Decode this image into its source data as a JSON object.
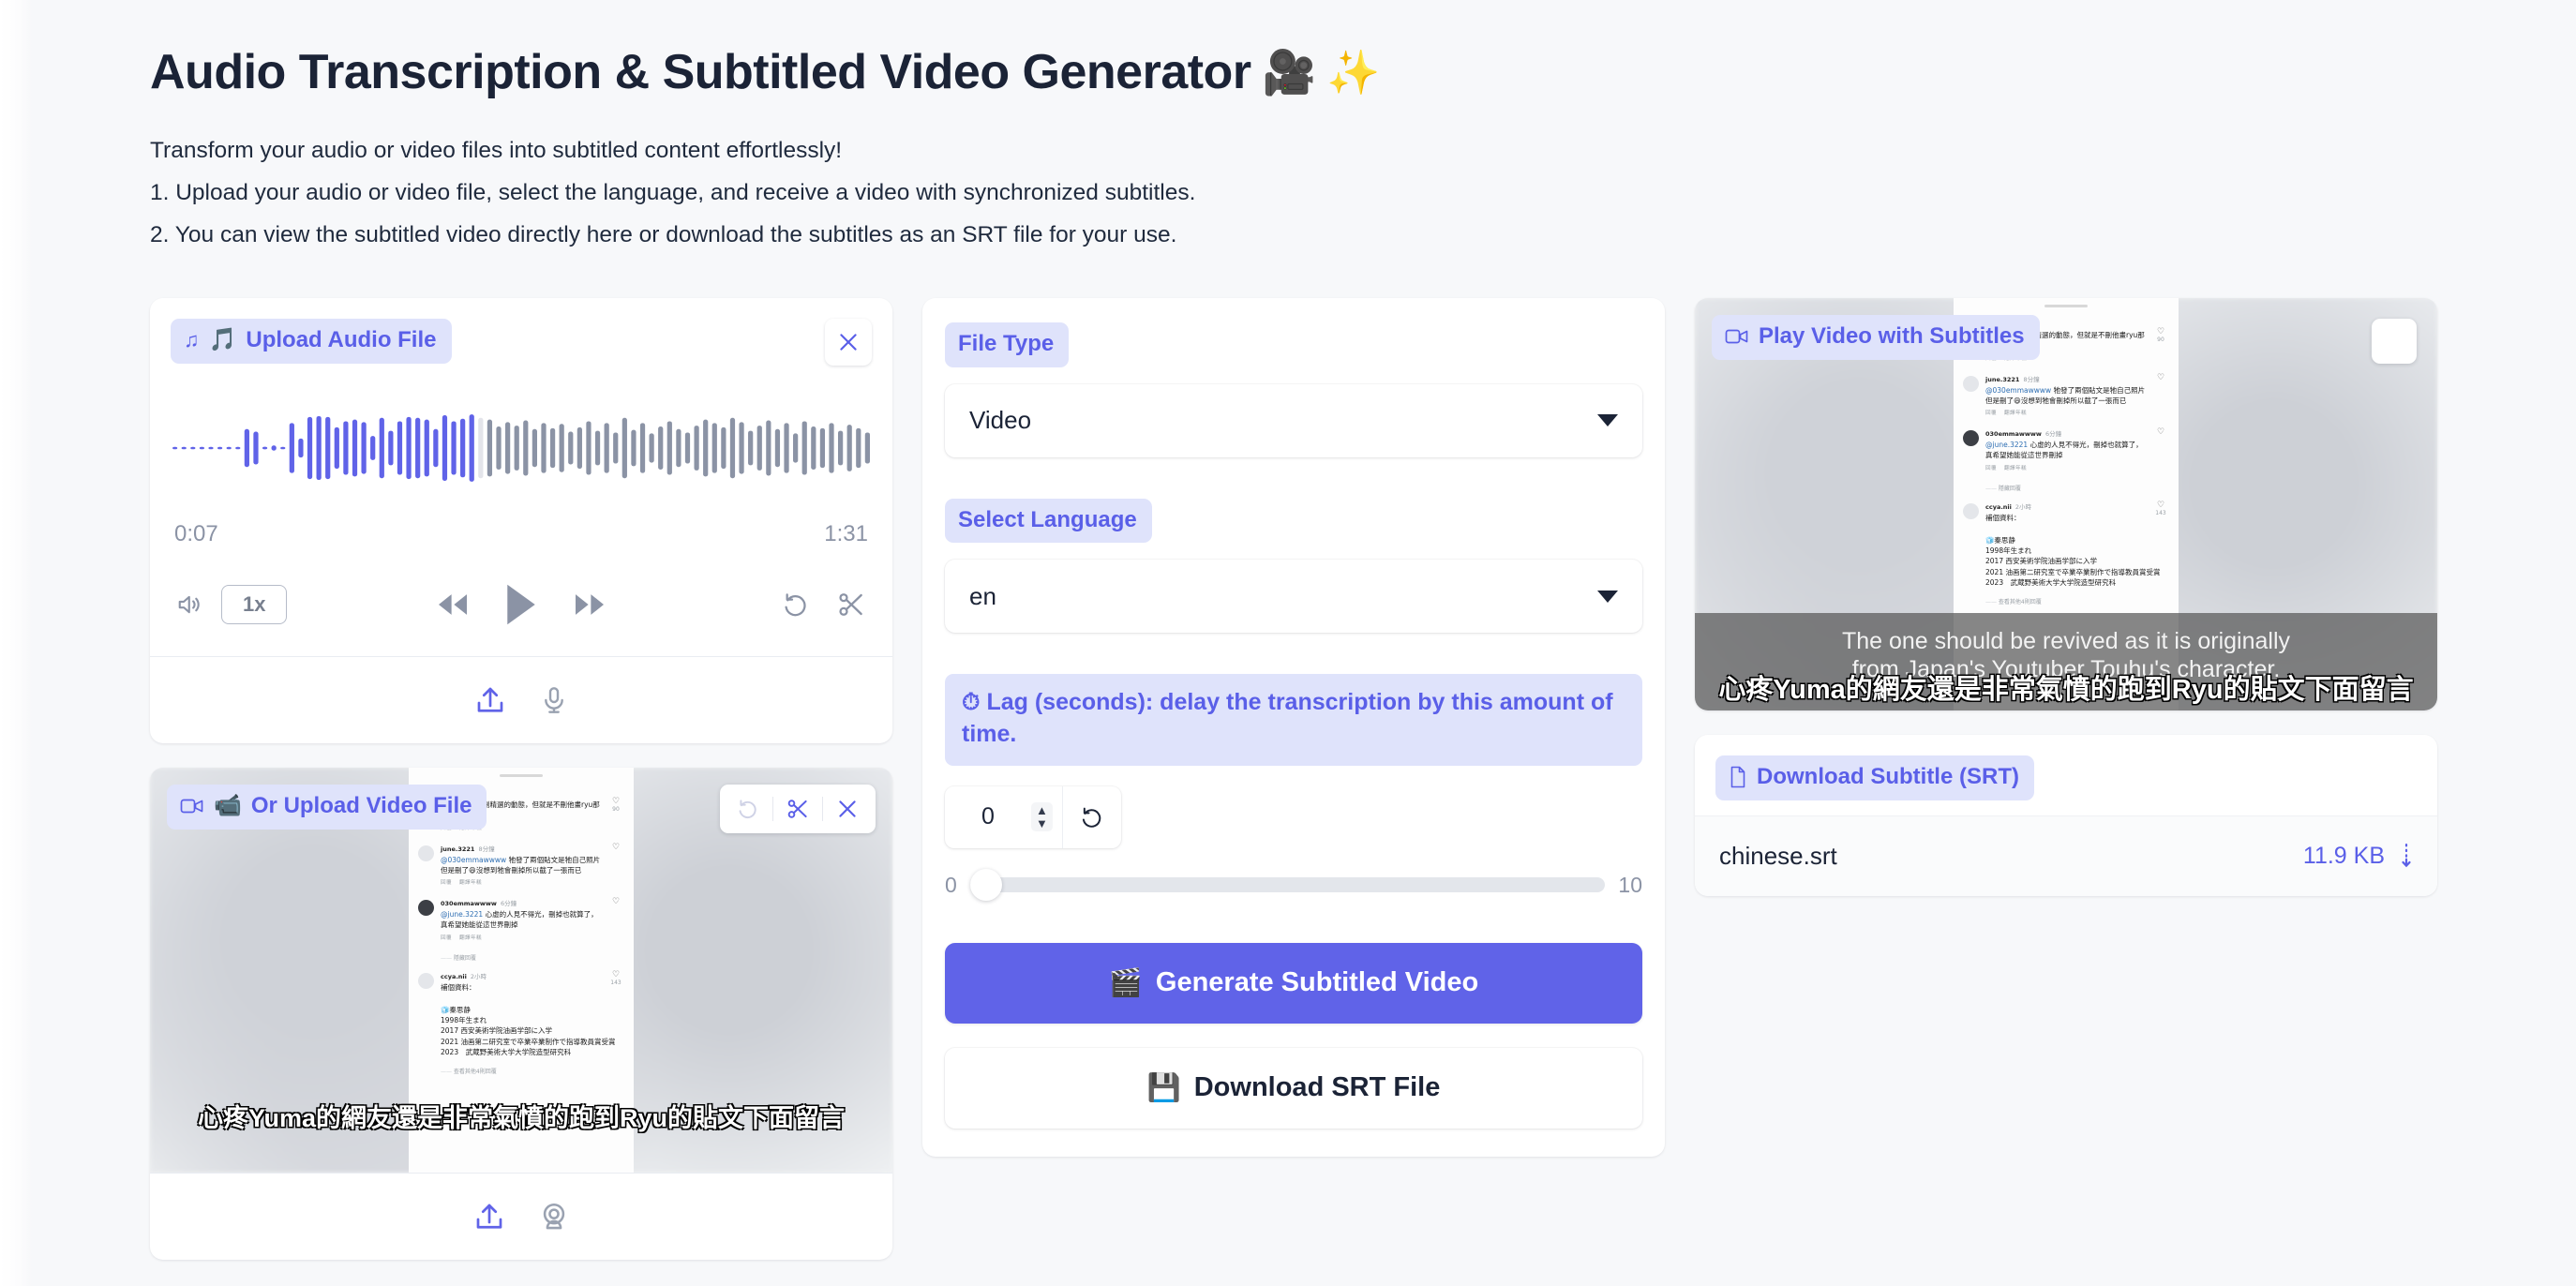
{
  "header": {
    "title": "Audio Transcription & Subtitled Video Generator",
    "title_emoji_1": "🎥",
    "title_emoji_2": "✨",
    "line1": "Transform your audio or video files into subtitled content effortlessly!",
    "line2": "1. Upload your audio or video file, select the language, and receive a video with synchronized subtitles.",
    "line3": "2. You can view the subtitled video directly here or download the subtitles as an SRT file for your use."
  },
  "audio_card": {
    "chip_icon": "music-note-icon",
    "chip_emoji": "🎵",
    "label": "Upload Audio File",
    "close_label": "×",
    "current_time": "0:07",
    "total_time": "1:31",
    "speed": "1x",
    "progress_percent": 44
  },
  "video_upload_card": {
    "chip_icon": "video-camera-icon",
    "chip_emoji": "📹",
    "label": "Or Upload Video File",
    "subtitle_text": "心疼Yuma的網友還是非常氣憤的跑到Ryu的貼文下面留言"
  },
  "settings": {
    "file_type_label": "File Type",
    "file_type_value": "Video",
    "language_label": "Select Language",
    "language_value": "en",
    "lag_label": "⏱ Lag (seconds): delay the transcription by this amount of time.",
    "lag_value": "0",
    "slider_min": "0",
    "slider_max": "10",
    "slider_value": 0,
    "generate_emoji": "🎬",
    "generate_label": "Generate Subtitled Video",
    "download_emoji": "💾",
    "download_label": "Download SRT File"
  },
  "play_card": {
    "chip_icon": "video-camera-icon",
    "label": "Play Video with Subtitles",
    "subtitle_en_line1": "The one should be revived as it is originally",
    "subtitle_en_line2": "from Japan's Youtuber Touhu's character.",
    "subtitle_zh": "心疼Yuma的網友還是非常氣憤的跑到Ryu的貼文下面留言"
  },
  "download_card": {
    "chip_icon": "document-icon",
    "label": "Download Subtitle (SRT)",
    "file_name": "chinese.srt",
    "file_size": "11.9 KB"
  },
  "video_frame": {
    "comments": [
      {
        "name": "",
        "time": "",
        "text": "，現在持續在刪精選的動態，但就是不刪他畫ryu那幅貼文喔",
        "mention": "",
        "actions": [
          "回覆",
          "翻譯年糕"
        ],
        "likes": "90"
      },
      {
        "name": "june.3221",
        "time": "8分鐘",
        "mention": "@030emmawwww",
        "text": "牠發了兩個貼文是牠自己照片 但是刪了😄沒想到牠會刪掉所以截了一張而已",
        "actions": [
          "回覆",
          "翻譯年糕"
        ],
        "likes": ""
      },
      {
        "name": "030emmawwww",
        "time": "6分鐘",
        "mention": "@june.3221",
        "text": "心虛的人見不得光，刪掉也就算了，真希望她能從這世界刪掉",
        "actions": [
          "回覆",
          "翻譯年糕"
        ],
        "likes": ""
      },
      {
        "name": "ccya.nii",
        "time": "2小時",
        "mention": "",
        "text": "補個資料：",
        "actions": [],
        "likes": "143"
      }
    ],
    "hide_replies": "隱藏回覆",
    "more_replies": "查看其他4則回覆",
    "bio_lines": [
      "🧊秦思静",
      "1998年生まれ",
      "2017 西安美術学院油画学部に入学",
      "2021 油画第二研究室で卒業卒業制作で指導教員賞受賞",
      "2023　武蔵野美術大学大学院造型研究科"
    ]
  },
  "colors": {
    "accent": "#6063E8",
    "chip_bg": "#DFE3FB",
    "page_bg": "#F7F8FA",
    "text": "#1B2336",
    "muted": "#8B93A5"
  }
}
